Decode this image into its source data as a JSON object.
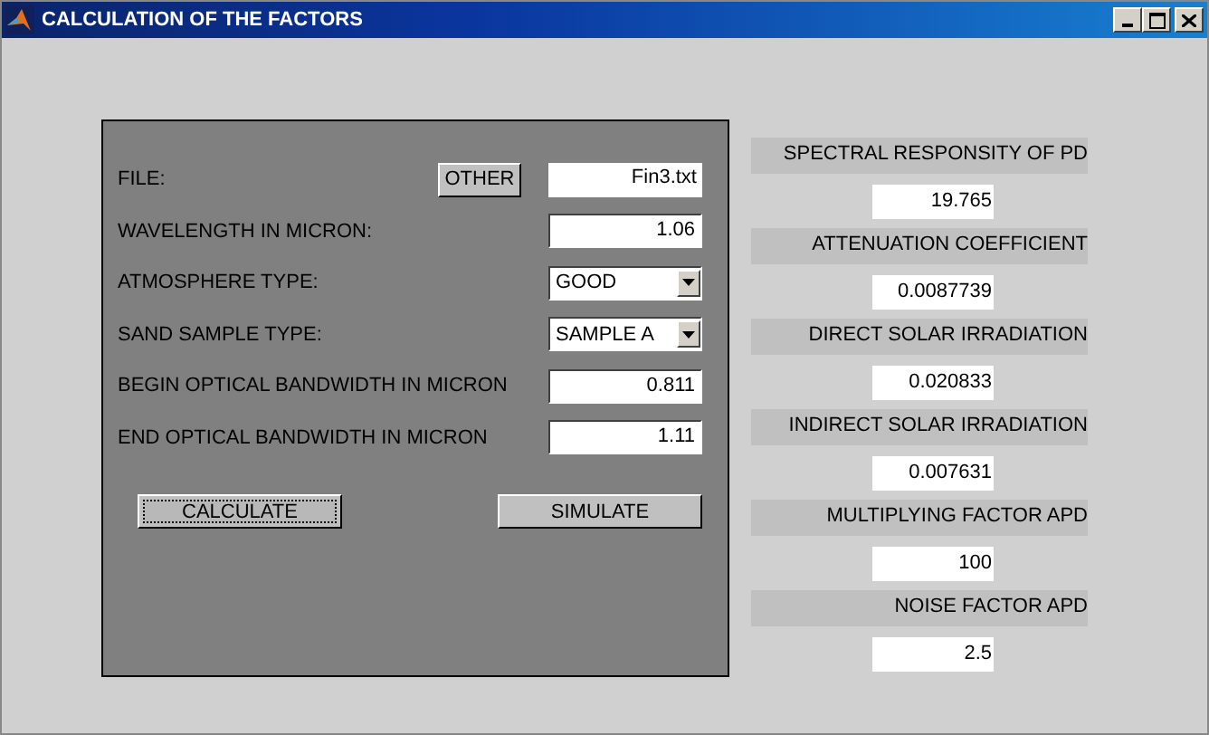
{
  "window": {
    "title": "CALCULATION OF THE FACTORS"
  },
  "inputs": [
    {
      "kind": "file",
      "label": "FILE:",
      "button": "OTHER",
      "value": "Fin3.txt"
    },
    {
      "kind": "input",
      "label": "WAVELENGTH IN MICRON:",
      "value": "1.06"
    },
    {
      "kind": "dropdown",
      "label": "ATMOSPHERE TYPE:",
      "value": "GOOD"
    },
    {
      "kind": "dropdown",
      "label": "SAND SAMPLE TYPE:",
      "value": "SAMPLE A"
    },
    {
      "kind": "input",
      "label": "BEGIN OPTICAL BANDWIDTH IN MICRON",
      "value": "0.811"
    },
    {
      "kind": "input",
      "label": "END OPTICAL BANDWIDTH IN MICRON",
      "value": "1.11"
    }
  ],
  "buttons": [
    {
      "label": "CALCULATE",
      "focused": true
    },
    {
      "label": "SIMULATE",
      "focused": false
    }
  ],
  "results": [
    {
      "label": "SPECTRAL RESPONSITY OF PD",
      "value": "19.765"
    },
    {
      "label": "ATTENUATION COEFFICIENT",
      "value": "0.0087739"
    },
    {
      "label": "DIRECT SOLAR IRRADIATION",
      "value": "0.020833"
    },
    {
      "label": "INDIRECT SOLAR IRRADIATION",
      "value": "0.007631"
    },
    {
      "label": "MULTIPLYING FACTOR APD",
      "value": "100"
    },
    {
      "label": "NOISE FACTOR APD",
      "value": "2.5"
    }
  ]
}
